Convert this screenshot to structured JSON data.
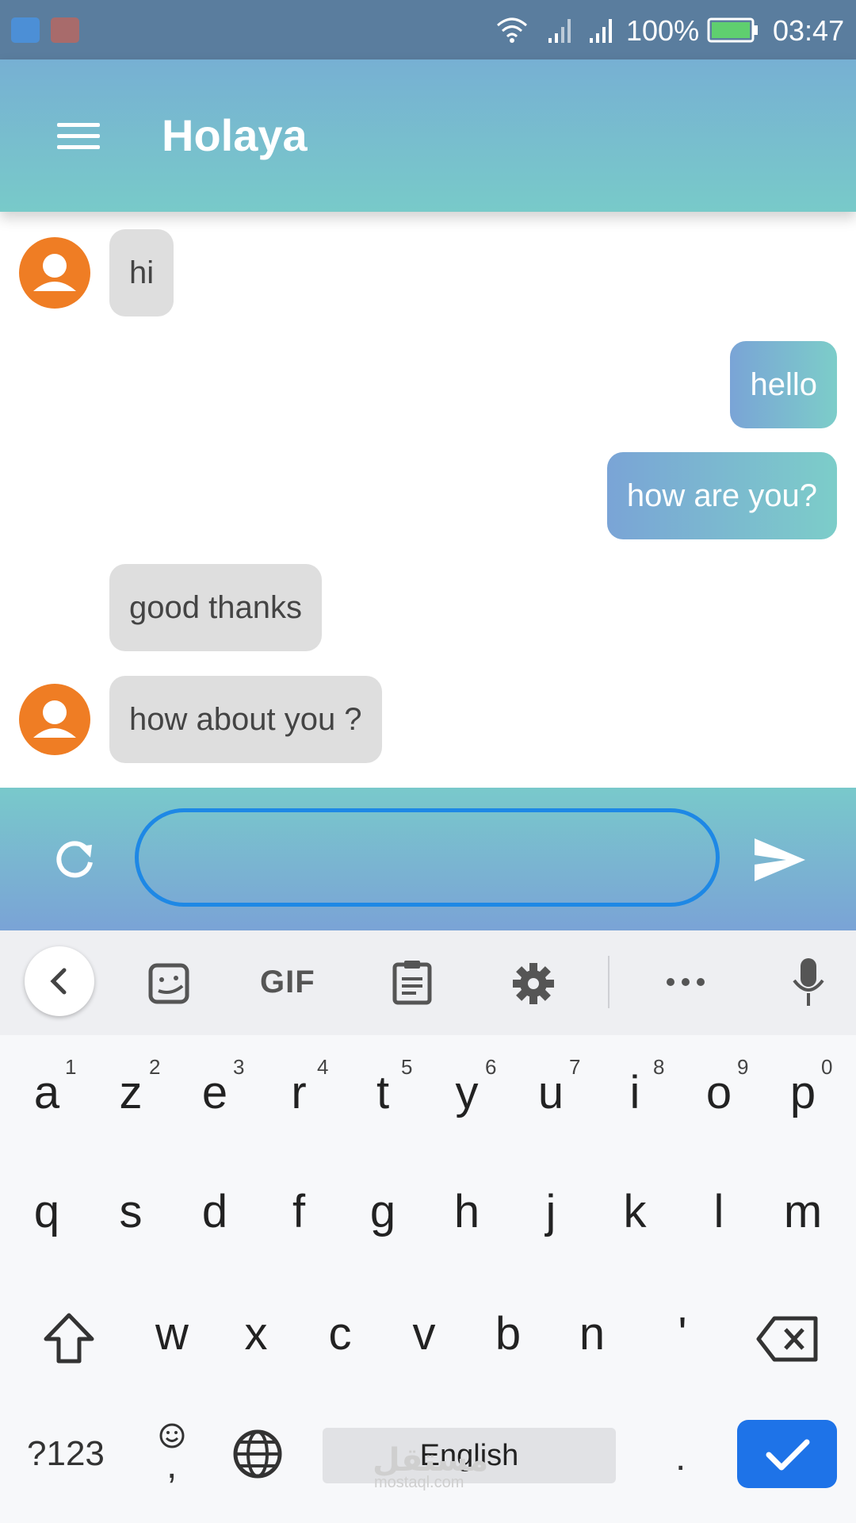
{
  "status_bar": {
    "battery": "100%",
    "time": "03:47"
  },
  "app_bar": {
    "title": "Holaya"
  },
  "messages": [
    {
      "text": "hi",
      "side": "incoming"
    },
    {
      "text": "hello",
      "side": "outgoing"
    },
    {
      "text": "how are you?",
      "side": "outgoing"
    },
    {
      "text": "good thanks",
      "side": "incoming"
    },
    {
      "text": "how about you ?",
      "side": "incoming"
    }
  ],
  "input": {
    "value": ""
  },
  "keyboard": {
    "toolbar": {
      "gif": "GIF"
    },
    "row1": [
      {
        "key": "a",
        "hint": "1"
      },
      {
        "key": "z",
        "hint": "2"
      },
      {
        "key": "e",
        "hint": "3"
      },
      {
        "key": "r",
        "hint": "4"
      },
      {
        "key": "t",
        "hint": "5"
      },
      {
        "key": "y",
        "hint": "6"
      },
      {
        "key": "u",
        "hint": "7"
      },
      {
        "key": "i",
        "hint": "8"
      },
      {
        "key": "o",
        "hint": "9"
      },
      {
        "key": "p",
        "hint": "0"
      }
    ],
    "row2": [
      "q",
      "s",
      "d",
      "f",
      "g",
      "h",
      "j",
      "k",
      "l",
      "m"
    ],
    "row3": [
      "w",
      "x",
      "c",
      "v",
      "b",
      "n",
      "'"
    ],
    "symbols_key": "?123",
    "comma_key": ",",
    "space_label": "English",
    "period_key": ".",
    "watermark": {
      "brand": "مستقل",
      "domain": "mostaql.com"
    }
  },
  "colors": {
    "app_bar_top": "#77b0d3",
    "app_bar_bottom": "#78cac9",
    "avatar": "#ef7d24",
    "incoming_bubble": "#dedede",
    "input_border": "#1e88e5",
    "enter_key": "#1e73e8"
  }
}
